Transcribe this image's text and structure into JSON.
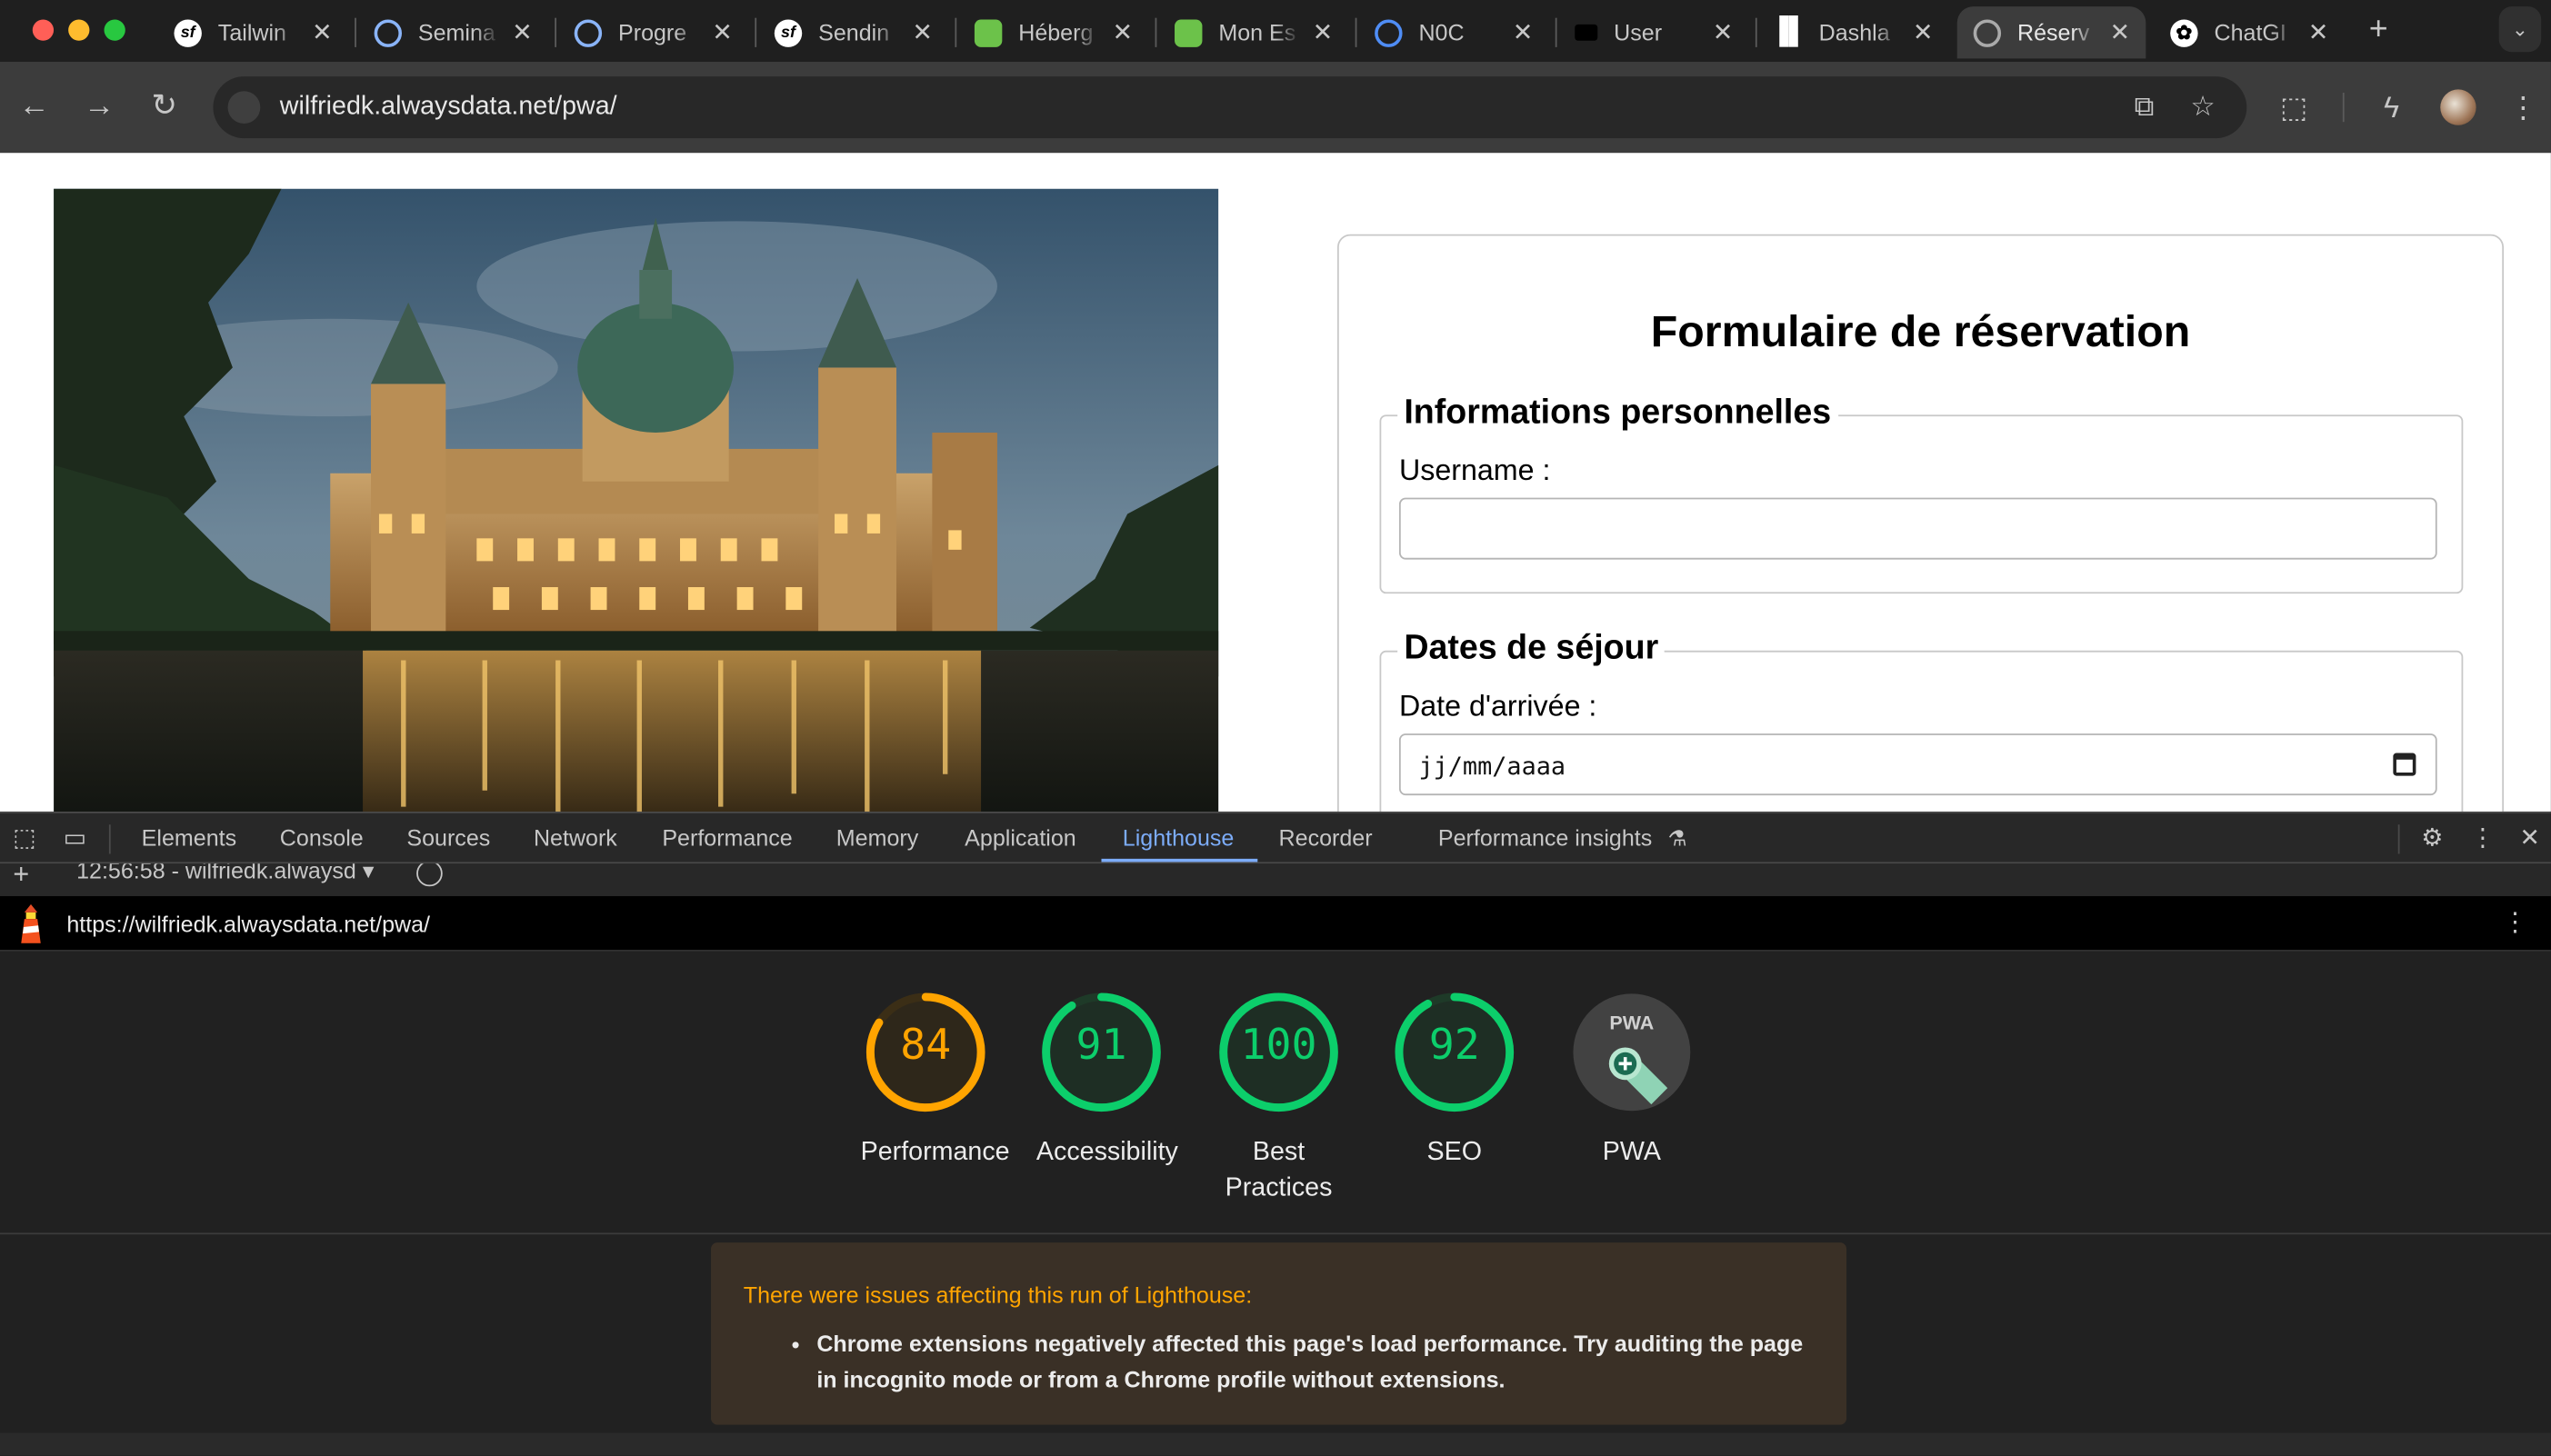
{
  "tabs": [
    {
      "title": "Tailwin",
      "icon": "symfony-icon"
    },
    {
      "title": "Semina",
      "icon": "globe-swirl-icon"
    },
    {
      "title": "Progre",
      "icon": "globe-swirl-icon"
    },
    {
      "title": "Sendin",
      "icon": "symfony-icon"
    },
    {
      "title": "Héberg",
      "icon": "leaf-icon"
    },
    {
      "title": "Mon Es",
      "icon": "leaf-icon"
    },
    {
      "title": "N0C",
      "icon": "n0c-icon"
    },
    {
      "title": "User",
      "icon": "page-icon"
    },
    {
      "title": "Dashla",
      "icon": "bars-icon"
    },
    {
      "title": "Réserv",
      "icon": "globe-icon",
      "active": true
    },
    {
      "title": "ChatGI",
      "icon": "openai-icon"
    }
  ],
  "address_bar": {
    "url": "wilfriedk.alwaysdata.net/pwa/"
  },
  "page": {
    "form_title": "Formulaire de réservation",
    "personal_legend": "Informations personnelles",
    "username_label": "Username :",
    "dates_legend": "Dates de séjour",
    "arrival_label": "Date d'arrivée :",
    "arrival_placeholder": "jj/mm/aaaa"
  },
  "devtools": {
    "tabs": [
      "Elements",
      "Console",
      "Sources",
      "Network",
      "Performance",
      "Memory",
      "Application",
      "Lighthouse",
      "Recorder",
      "Performance insights"
    ],
    "active_tab": "Lighthouse",
    "run_label": "12:56:58 - wilfriedk.alwaysd",
    "report_url": "https://wilfriedk.alwaysdata.net/pwa/"
  },
  "scores": [
    {
      "label": "Performance",
      "value": 84
    },
    {
      "label": "Accessibility",
      "value": 91
    },
    {
      "label": "Best Practices",
      "value": 100
    },
    {
      "label": "SEO",
      "value": 92
    }
  ],
  "pwa": {
    "label": "PWA",
    "badge": "PWA"
  },
  "colors": {
    "average": "#ffa400",
    "pass": "#0cce6b",
    "link": "#7cacf8"
  },
  "warning": {
    "title": "There were issues affecting this run of Lighthouse:",
    "items": [
      "Chrome extensions negatively affected this page's load performance. Try auditing the page in incognito mode or from a Chrome profile without extensions."
    ]
  }
}
